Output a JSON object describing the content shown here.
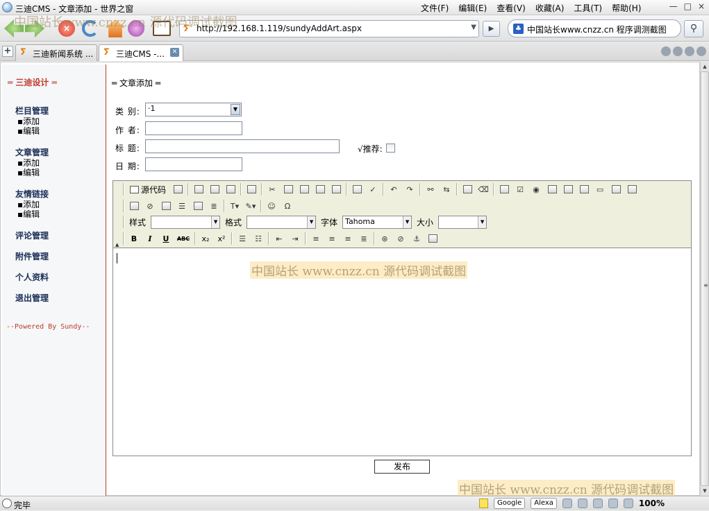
{
  "window": {
    "title": "三迪CMS - 文章添加 - 世界之窗",
    "menus": [
      "文件(F)",
      "编辑(E)",
      "查看(V)",
      "收藏(A)",
      "工具(T)",
      "帮助(H)"
    ],
    "controls": [
      "—",
      "□",
      "×"
    ]
  },
  "toolbar": {
    "address": "http://192.168.1.119/sundyAddArt.aspx",
    "search_text": "中国站长www.cnzz.cn 程序调测截图"
  },
  "tabs": [
    {
      "label": "三迪新闻系统 ..."
    },
    {
      "label": "三迪CMS -..."
    }
  ],
  "sidebar": {
    "brand": "═ 三迪设计 ═",
    "groups": [
      {
        "title": "栏目管理",
        "items": [
          "添加",
          "编辑"
        ]
      },
      {
        "title": "文章管理",
        "items": [
          "添加",
          "编辑"
        ]
      },
      {
        "title": "友情链接",
        "items": [
          "添加",
          "编辑"
        ]
      },
      {
        "title": "评论管理"
      },
      {
        "title": "附件管理"
      },
      {
        "title": "个人资料"
      },
      {
        "title": "退出管理"
      }
    ],
    "powered": "--Powered By Sundy--"
  },
  "form": {
    "section_title": "═ 文章添加 ═",
    "category_label": "类 别:",
    "category_value": "·1",
    "author_label": "作 者:",
    "title_label": "标 题:",
    "recommend_label": "√推荐:",
    "date_label": "日 期:",
    "publish_button": "发布"
  },
  "editor": {
    "source_label": "源代码",
    "style_label": "样式",
    "format_label": "格式",
    "font_label": "字体",
    "font_value": "Tahoma",
    "size_label": "大小",
    "bold": "B",
    "italic": "I",
    "underline": "U",
    "strike": "ABC",
    "sub": "x₂",
    "sup": "x²"
  },
  "watermarks": {
    "top": "中国站长www.cnzz.cn 源代码调试截图",
    "middle": "中国站长 www.cnzz.cn 源代码调试截图",
    "bottom": "中国站长 www.cnzz.cn 源代码调试截图"
  },
  "status": {
    "text": "完毕",
    "google": "Google",
    "alexa": "Alexa",
    "zoom": "100%"
  }
}
